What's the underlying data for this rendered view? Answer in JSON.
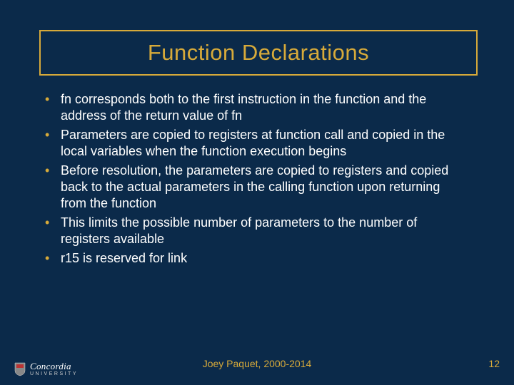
{
  "title": "Function Declarations",
  "bullets": {
    "b0": "fn corresponds both to the first instruction in the function and the address of the return value of fn",
    "b1": "Parameters are copied to registers at function call and copied in the local variables when the function execution begins",
    "b2": "Before resolution, the parameters are copied to registers and copied back to the actual parameters in the calling function upon returning from the function",
    "b3": "This limits the possible number of parameters to the number of registers available",
    "b4": "r15 is reserved for link"
  },
  "footer": {
    "center": "Joey Paquet, 2000-2014",
    "page": "12"
  },
  "logo": {
    "name": "Concordia",
    "university": "UNIVERSITY"
  }
}
